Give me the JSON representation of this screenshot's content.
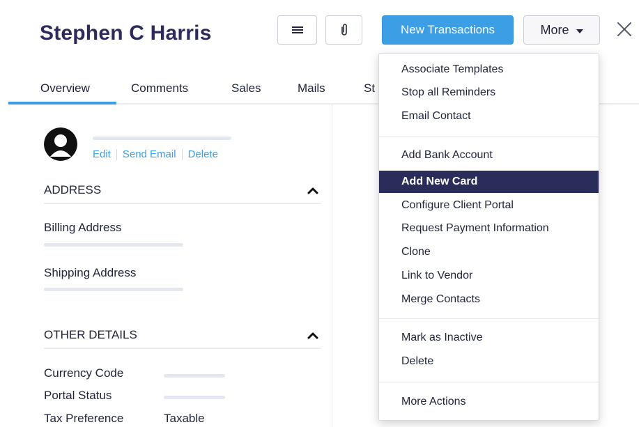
{
  "header": {
    "title": "Stephen C Harris",
    "menu_icon": "hamburger-icon",
    "attach_icon": "paperclip-icon",
    "new_transactions_label": "New Transactions",
    "more_label": "More",
    "close_icon": "close-icon"
  },
  "tabs": [
    {
      "label": "Overview",
      "active": true
    },
    {
      "label": "Comments",
      "active": false
    },
    {
      "label": "Sales",
      "active": false
    },
    {
      "label": "Mails",
      "active": false
    },
    {
      "label": "St",
      "active": false
    }
  ],
  "contact": {
    "actions": [
      "Edit",
      "Send Email",
      "Delete"
    ]
  },
  "address": {
    "heading": "ADDRESS",
    "billing_label": "Billing Address",
    "shipping_label": "Shipping Address"
  },
  "other_details": {
    "heading": "OTHER DETAILS",
    "fields": [
      {
        "label": "Currency Code",
        "value": ""
      },
      {
        "label": "Portal Status",
        "value": ""
      },
      {
        "label": "Tax Preference",
        "value": "Taxable"
      }
    ]
  },
  "more_menu": {
    "groups": [
      [
        "Associate Templates",
        "Stop all Reminders",
        "Email Contact"
      ],
      [
        "Add Bank Account",
        "Add New Card",
        "Configure Client Portal",
        "Request Payment Information",
        "Clone",
        "Link to Vendor",
        "Merge Contacts"
      ],
      [
        "Mark as Inactive",
        "Delete"
      ],
      [
        "More Actions"
      ]
    ],
    "highlighted": "Add New Card"
  },
  "colors": {
    "accent": "#3c9ee5",
    "title": "#2d2a5e",
    "highlight": "#2a2c59"
  }
}
